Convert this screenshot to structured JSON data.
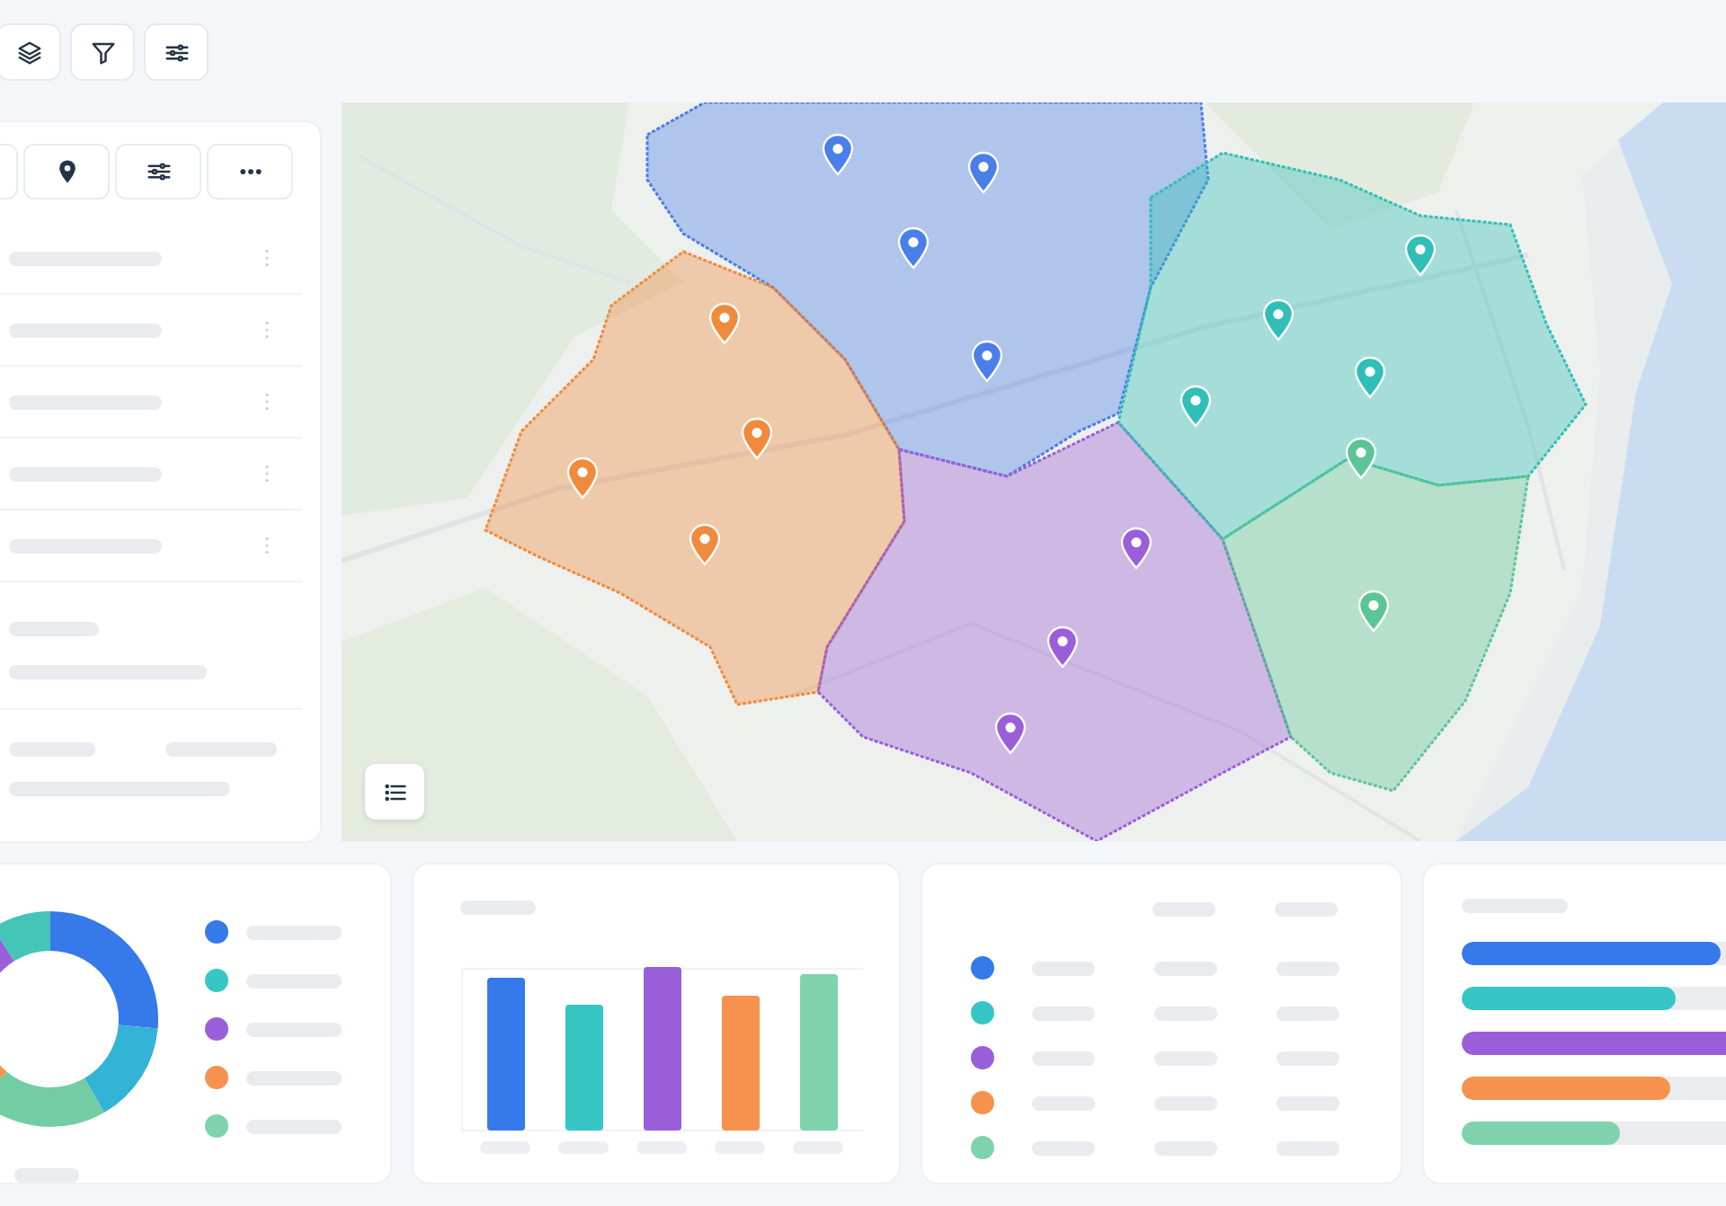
{
  "toolbar": {
    "buttons": [
      {
        "kind": "layers"
      },
      {
        "kind": "filter"
      },
      {
        "kind": "sliders"
      }
    ]
  },
  "sidebar": {
    "tabs": [
      {
        "kind": "blank"
      },
      {
        "kind": "pin"
      },
      {
        "kind": "sliders"
      },
      {
        "kind": "more"
      }
    ]
  },
  "map": {
    "regions": [
      {
        "color": "#4a7ee8"
      },
      {
        "color": "#f08a3c"
      },
      {
        "color": "#9a5fd8"
      },
      {
        "color": "#2fbfb6"
      },
      {
        "color": "#5cc597"
      }
    ]
  },
  "donut_card": {
    "segments": [
      {
        "color": "#3579ea"
      },
      {
        "color": "#33b3d6"
      },
      {
        "color": "#72cda3"
      },
      {
        "color": "#f7924e"
      },
      {
        "color": "#9a5fd8"
      },
      {
        "color": "#45c4b8"
      }
    ],
    "legend": [
      {
        "color": "#3579ea"
      },
      {
        "color": "#36c6c6"
      },
      {
        "color": "#9a5fd8"
      },
      {
        "color": "#f7924e"
      },
      {
        "color": "#7ed3ad"
      }
    ]
  },
  "bar_card": {
    "bars": [
      {
        "color": "#3579ea"
      },
      {
        "color": "#36c6c6"
      },
      {
        "color": "#9a5fd8"
      },
      {
        "color": "#f7924e"
      },
      {
        "color": "#7ed3ad"
      }
    ]
  },
  "table_card": {
    "rows": [
      {
        "color": "#3579ea"
      },
      {
        "color": "#36c6c6"
      },
      {
        "color": "#9a5fd8"
      },
      {
        "color": "#f7924e"
      },
      {
        "color": "#7ed3ad"
      }
    ]
  },
  "progress_card": {
    "bars": [
      {
        "color": "#3579ea",
        "level": 0.82
      },
      {
        "color": "#36c6c6",
        "level": 0.68
      },
      {
        "color": "#9a5fd8",
        "level": 1
      },
      {
        "color": "#f7924e",
        "level": 0.66
      },
      {
        "color": "#7ed3ad",
        "level": 0.5
      }
    ]
  }
}
